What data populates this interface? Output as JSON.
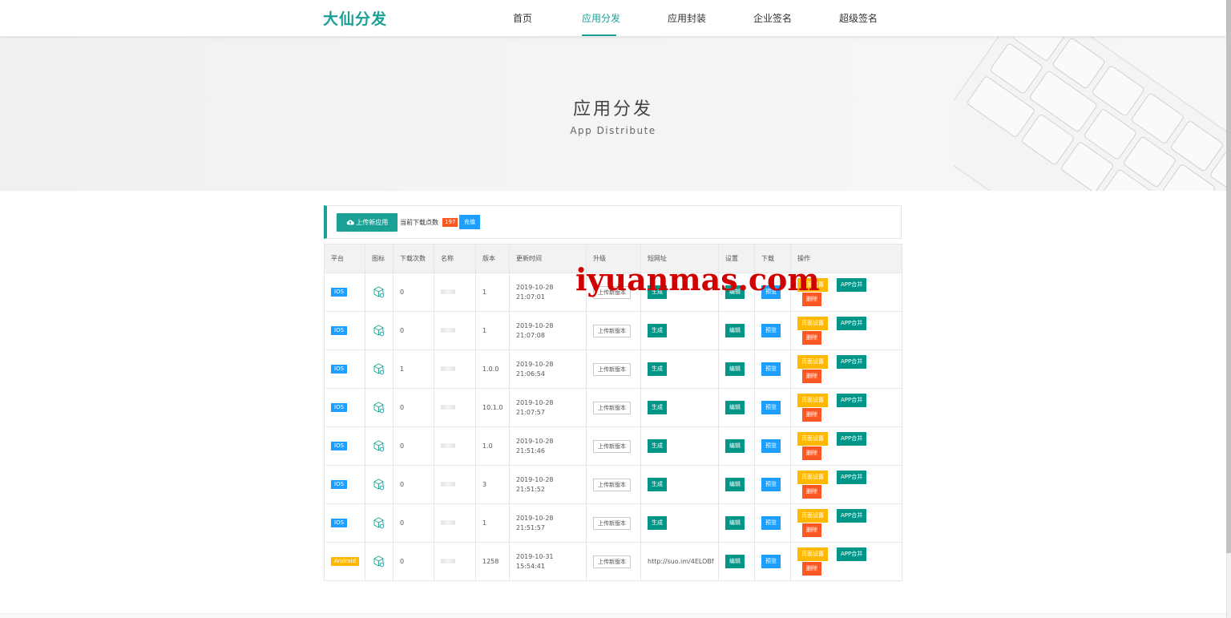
{
  "header": {
    "logo": "大仙分发",
    "nav": [
      "首页",
      "应用分发",
      "应用封装",
      "企业签名",
      "超级签名"
    ],
    "active_index": 1
  },
  "banner": {
    "title": "应用分发",
    "subtitle": "App Distribute"
  },
  "toolbar": {
    "upload_label": "上传新应用",
    "download_count_label": "当前下载点数",
    "download_count": "197",
    "recharge_label": "充值"
  },
  "table": {
    "columns": [
      "平台",
      "图标",
      "下载次数",
      "名称",
      "版本",
      "更新时间",
      "升级",
      "短网址",
      "设置",
      "下载",
      "操作"
    ],
    "upgrade_label": "上传新版本",
    "generate_label": "生成",
    "edit_label": "编辑",
    "preview_label": "预览",
    "page_settings_label": "页面设置",
    "app_merge_label": "APP合并",
    "delete_label": "删除",
    "rows": [
      {
        "platform": "IOS",
        "downloads": "0",
        "version": "1",
        "date": "2019-10-28",
        "time": "21:07:01",
        "short_url": ""
      },
      {
        "platform": "IOS",
        "downloads": "0",
        "version": "1",
        "date": "2019-10-28",
        "time": "21:07:08",
        "short_url": ""
      },
      {
        "platform": "IOS",
        "downloads": "1",
        "version": "1.0.0",
        "date": "2019-10-28",
        "time": "21:06:54",
        "short_url": ""
      },
      {
        "platform": "IOS",
        "downloads": "0",
        "version": "10.1.0",
        "date": "2019-10-28",
        "time": "21:07:57",
        "short_url": ""
      },
      {
        "platform": "IOS",
        "downloads": "0",
        "version": "1.0",
        "date": "2019-10-28",
        "time": "21:51:46",
        "short_url": ""
      },
      {
        "platform": "IOS",
        "downloads": "0",
        "version": "3",
        "date": "2019-10-28",
        "time": "21:51:52",
        "short_url": ""
      },
      {
        "platform": "IOS",
        "downloads": "0",
        "version": "1",
        "date": "2019-10-28",
        "time": "21:51:57",
        "short_url": ""
      },
      {
        "platform": "Android",
        "downloads": "0",
        "version": "1258",
        "date": "2019-10-31",
        "time": "15:54:41",
        "short_url": "http://suo.im/4ELOBf"
      }
    ]
  },
  "watermark": "iyuanmas.com",
  "colors": {
    "primary": "#1aa094",
    "green": "#009688",
    "blue": "#1e9fff",
    "orange": "#ffb800",
    "red": "#ff5722"
  }
}
